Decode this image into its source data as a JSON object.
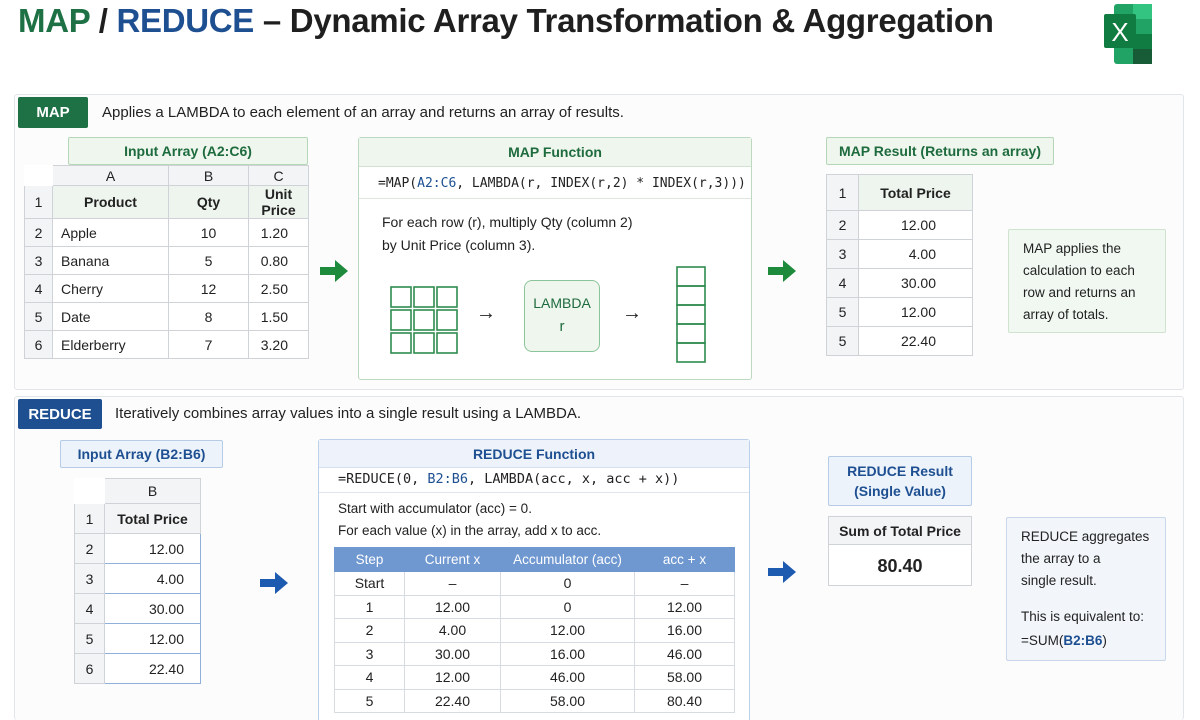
{
  "title": {
    "map": "MAP",
    "slash": " / ",
    "reduce": "REDUCE",
    "rest": " – Dynamic Array Transformation & Aggregation"
  },
  "logo": {
    "letter": "X"
  },
  "colors": {
    "map_green": "#1e7145",
    "reduce_blue": "#1d4f91",
    "header_blue": "#6f97d0",
    "excel_green": "#21a366"
  },
  "map": {
    "tag": "MAP",
    "description": "Applies a LAMBDA to each element of an array and returns an array of results.",
    "input_label": "Input Array (A2:C6)",
    "col_letters": [
      "A",
      "B",
      "C"
    ],
    "row_numbers": [
      "1",
      "2",
      "3",
      "4",
      "5",
      "6"
    ],
    "headers": [
      "Product",
      "Qty",
      "Unit Price"
    ],
    "rows": [
      [
        "Apple",
        "10",
        "1.20"
      ],
      [
        "Banana",
        "5",
        "0.80"
      ],
      [
        "Cherry",
        "12",
        "2.50"
      ],
      [
        "Date",
        "8",
        "1.50"
      ],
      [
        "Elderberry",
        "7",
        "3.20"
      ]
    ],
    "function": {
      "title": "MAP Function",
      "formula_start": "=MAP(",
      "formula_ref": "A2:C6",
      "formula_end": ", LAMBDA(r, INDEX(r,2) * INDEX(r,3)))",
      "explain_1": "For each row (r), multiply Qty (column 2)",
      "explain_2": "by Unit Price (column 3).",
      "lambda_label": "LAMBDA",
      "lambda_param": "r",
      "flow_arrow": "→"
    },
    "result_label": "MAP Result (Returns an array)",
    "result_rows": [
      "1",
      "2",
      "3",
      "4",
      "5",
      "5"
    ],
    "result_header": "Total Price",
    "result_values": [
      "12.00",
      "4.00",
      "30.00",
      "12.00",
      "22.40"
    ],
    "note": [
      "MAP applies the",
      "calculation to each",
      "row and returns an",
      "array of totals."
    ]
  },
  "reduce": {
    "tag": "REDUCE",
    "description": "Iteratively combines array values into a single result using a LAMBDA.",
    "input_label": "Input Array (B2:B6)",
    "col_letter": "B",
    "row_numbers": [
      "1",
      "2",
      "3",
      "4",
      "5",
      "6"
    ],
    "header": "Total Price",
    "values": [
      "12.00",
      "4.00",
      "30.00",
      "12.00",
      "22.40"
    ],
    "function": {
      "title": "REDUCE Function",
      "formula_start": "=REDUCE(0, ",
      "formula_ref": "B2:B6",
      "formula_end": ", LAMBDA(acc, x, acc + x))",
      "explain_1": "Start with accumulator (acc) = 0.",
      "explain_2": "For each value (x) in the array, add x to acc.",
      "table_headers": [
        "Step",
        "Current x",
        "Accumulator (acc)",
        "acc + x"
      ],
      "table_rows": [
        [
          "Start",
          "–",
          "0",
          "–"
        ],
        [
          "1",
          "12.00",
          "0",
          "12.00"
        ],
        [
          "2",
          "4.00",
          "12.00",
          "16.00"
        ],
        [
          "3",
          "30.00",
          "16.00",
          "46.00"
        ],
        [
          "4",
          "12.00",
          "46.00",
          "58.00"
        ],
        [
          "5",
          "22.40",
          "58.00",
          "80.40"
        ]
      ]
    },
    "result_label_1": "REDUCE Result",
    "result_label_2": "(Single Value)",
    "result_header": "Sum of Total Price",
    "result_value": "80.40",
    "note_1": [
      "REDUCE aggregates",
      "the array to a",
      "single result."
    ],
    "note_2": "This is equivalent to:",
    "note_formula_start": "=SUM(",
    "note_formula_ref": "B2:B6",
    "note_formula_end": ")"
  }
}
